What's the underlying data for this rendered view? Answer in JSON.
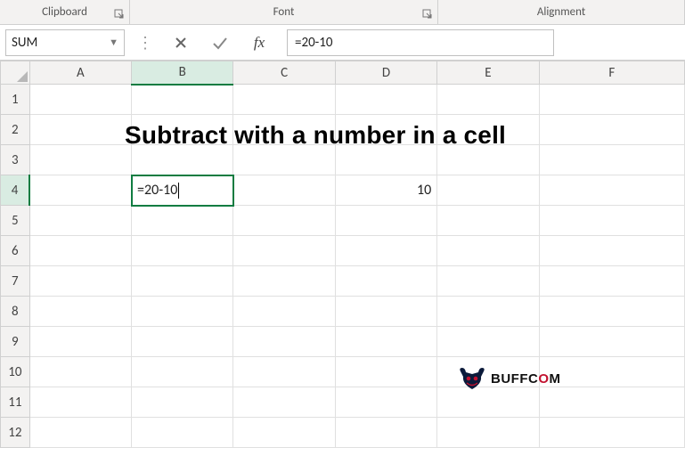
{
  "ribbon": {
    "clipboard_label": "Clipboard",
    "font_label": "Font",
    "alignment_label": "Alignment"
  },
  "namebox": {
    "value": "SUM"
  },
  "formula_bar": {
    "fx_label": "fx",
    "value": "=20-10"
  },
  "columns": [
    "A",
    "B",
    "C",
    "D",
    "E",
    "F"
  ],
  "rows": [
    "1",
    "2",
    "3",
    "4",
    "5",
    "6",
    "7",
    "8",
    "9",
    "10",
    "11",
    "12"
  ],
  "active": {
    "col": "B",
    "row": "4"
  },
  "cells": {
    "B4": "=20-10",
    "D4": "10"
  },
  "overlay_title": "Subtract with a number in a cell",
  "watermark": {
    "text_pre": "BUFFC",
    "text_o": "O",
    "text_post": "M"
  }
}
